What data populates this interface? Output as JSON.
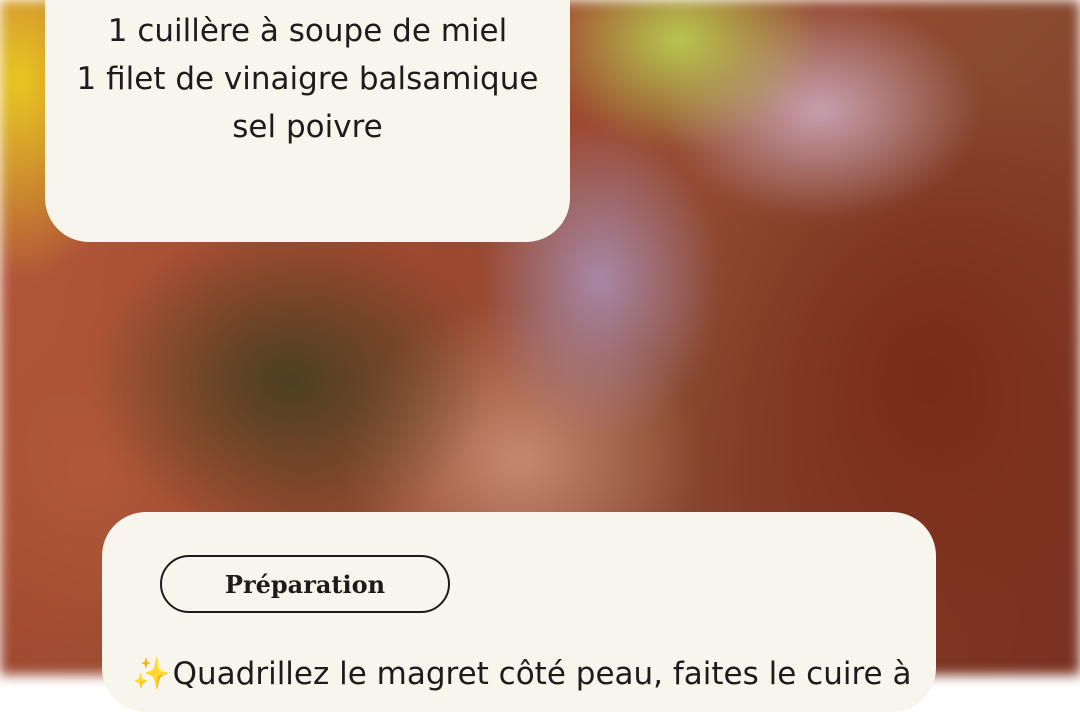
{
  "ingredients": {
    "lines": [
      "1 cuillère à soupe de miel",
      "1 filet de vinaigre balsamique",
      "sel poivre"
    ]
  },
  "preparation": {
    "title": "Préparation",
    "sparkle_icon": "✨",
    "step_text": "Quadrillez le magret côté peau, faites  le cuire à la"
  },
  "colors": {
    "card_background": "#f8f6ec",
    "text": "#1c1c1c",
    "sparkle": "#f2b21c"
  }
}
